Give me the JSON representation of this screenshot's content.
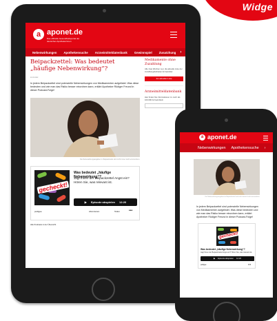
{
  "badge": {
    "text": "Widge"
  },
  "tablet": {
    "brand": {
      "logo_letter": "a",
      "name": "aponet.de",
      "tagline": "Das offizielle Gesundheitsportal der deutschen Apothekerinnen"
    },
    "nav": [
      "Nebenwirkungen",
      "Apothekensuche",
      "Arzneimitteldatenbank",
      "Gewinnspiel",
      "Zusatzhung"
    ],
    "article": {
      "title": "Beipackzettel: Was bedeutet „häufige Nebenwirkung“?",
      "date": "xx.xx.xxxx",
      "lead": "In jedem Beipackzettel sind potenzielle Nebenwirkungen von Medikamenten aufgelistet. Was diese bedeuten und wie man das Risiko besser einordnen kann, erklärt Apotheker Rüdiger Freund in dieser Podcast-Folge!",
      "photo_caption": "Die Nebenwirkungsangaben im Beipackzettel sind nicht immer leicht einzuordnen."
    },
    "player": {
      "cover_title": "gecheckt!",
      "episode_title": "Was bedeutet „häufige Nebenwirkung“?",
      "episode_desc": "Jagt Ihnen der Beipackzettel Angst ein? Hören Sie, was relevant ist.",
      "play_label": "Episode abspielen",
      "duration": "12:20",
      "brand": "podigee",
      "subscribe_label": "Abonnieren",
      "share_label": "Teilen",
      "more_label": "•••",
      "all_podcasts": "Alle Podcasts in der Übersicht"
    },
    "sidebar": {
      "heading1": "Medikamente ohne Zuzahlung",
      "text1": "Alle zwei Wochen neu: die aktuelle Liste der zuzahlungsbefreiten Arzneimittel",
      "button1": "Zur aktuellen Liste",
      "heading2": "Arzneimitteldatenbank",
      "text2": "Hier finden Sie Informationen zu mehr als 100.000 Arzneimitteln"
    }
  },
  "phone": {
    "brand": {
      "logo_letter": "a",
      "name": "aponet.de"
    },
    "nav": [
      "Nebenwirkungen",
      "Apothekensuche"
    ],
    "photo_caption": "Die Nebenwirkungsangaben im Beipackzettel sind nicht immer leicht einzuordnen.",
    "text": "In jedem Beipackzettel sind potenzielle Nebenwirkungen von Medikamenten aufgelistet. Was diese bedeuten und wie man das Risiko besser einordnen kann, erklärt Apotheker Rüdiger Freund in dieser Podcast-Folge!",
    "player": {
      "cover_title": "gecheckt!",
      "episode_title": "Was bedeutet „häufige Nebenwirkung“?",
      "episode_desc": "Jagt Ihnen der Beipackzettel Angst ein? Hören Sie, was relevant ist.",
      "play_label": "Episode abspielen",
      "duration": "12:20",
      "brand": "podigee",
      "more_label": "•••"
    }
  },
  "colors": {
    "brand_red": "#e30613",
    "nav_red": "#c70512",
    "device": "#1b1b1b"
  }
}
